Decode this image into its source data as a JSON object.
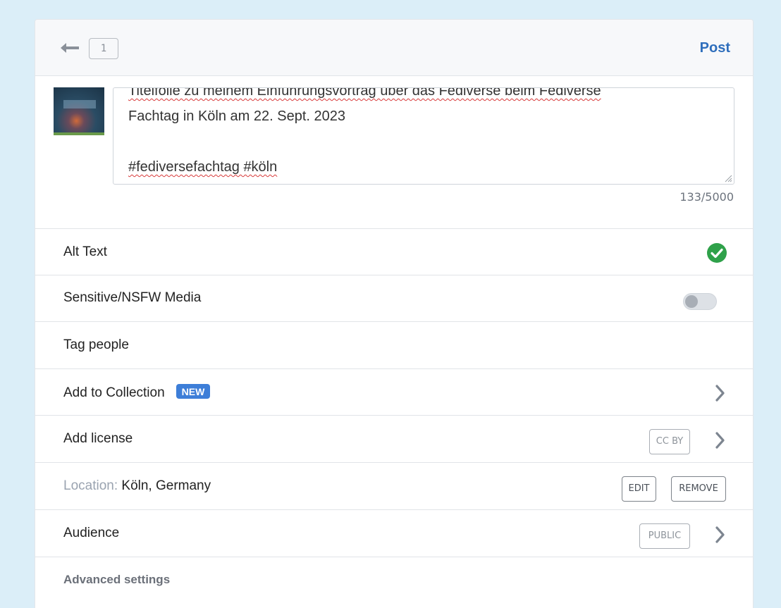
{
  "header": {
    "page_count": "1",
    "post_label": "Post"
  },
  "compose": {
    "caption_line1": "Titelfolie zu meinem Einführungsvortrag über das Fediverse beim Fediverse",
    "caption_line2": "Fachtag in Köln am 22. Sept. 2023",
    "caption_hashtags": "#fediversefachtag #köln",
    "char_counter": "133/5000"
  },
  "options": {
    "alt_text_label": "Alt Text",
    "sensitive_label": "Sensitive/NSFW Media",
    "sensitive_enabled": false,
    "tag_people_label": "Tag people",
    "collection_label": "Add to Collection",
    "collection_badge": "NEW",
    "license_label": "Add license",
    "license_value": "CC BY",
    "location_prefix": "Location:",
    "location_value": "Köln, Germany",
    "location_edit": "EDIT",
    "location_remove": "REMOVE",
    "audience_label": "Audience",
    "audience_value": "PUBLIC",
    "advanced_label": "Advanced settings"
  },
  "colors": {
    "accent": "#2e6ebc",
    "success": "#2fa14a",
    "badge": "#3d7ed8",
    "page_background": "#dbeef8"
  },
  "icons": [
    "back-arrow-icon",
    "check-circle-icon",
    "chevron-right-icon",
    "resize-handle-icon"
  ]
}
